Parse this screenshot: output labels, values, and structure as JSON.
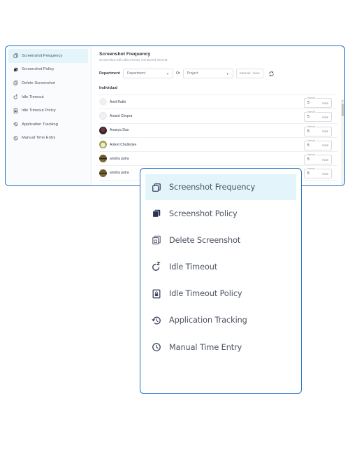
{
  "sidebar": {
    "items": [
      {
        "label": "Screenshot Frequency",
        "icon": "copy-icon",
        "active": true
      },
      {
        "label": "Screenshot Policy",
        "icon": "stacked-files-icon",
        "active": false
      },
      {
        "label": "Delete Screenshot",
        "icon": "delete-files-icon",
        "active": false
      },
      {
        "label": "Idle Timeout",
        "icon": "sleep-refresh-icon",
        "active": false
      },
      {
        "label": "Idle Timeout Policy",
        "icon": "locked-document-icon",
        "active": false
      },
      {
        "label": "Application Tracking",
        "icon": "history-icon",
        "active": false
      },
      {
        "label": "Manual Time Entry",
        "icon": "clock-icon",
        "active": false
      }
    ]
  },
  "main": {
    "title": "Screenshot Frequency",
    "subtitle": "Screenshot will collect below mentioned interval.",
    "filters": {
      "department_label": "Department",
      "department_value": "Department",
      "or_label": "Or",
      "project_value": "Project",
      "interval_placeholder": "Interval",
      "interval_unit": "mins"
    },
    "section_label": "Individual",
    "rows": [
      {
        "name": "Amit Rathi",
        "interval_label": "Interval",
        "interval": "5",
        "unit": "mins"
      },
      {
        "name": "Anand Chopra",
        "interval_label": "Interval",
        "interval": "5",
        "unit": "mins"
      },
      {
        "name": "Ananya Das",
        "interval_label": "Interval",
        "interval": "5",
        "unit": "mins"
      },
      {
        "name": "Aniket Chatterjee",
        "interval_label": "Interval",
        "interval": "5",
        "unit": "mins"
      },
      {
        "name": "anisha patra",
        "interval_label": "Interval",
        "interval": "5",
        "unit": "mins"
      },
      {
        "name": "anisha patra",
        "interval_label": "Interval",
        "interval": "5",
        "unit": "mins"
      }
    ]
  },
  "colors": {
    "accent_border": "#1f6fc4",
    "active_bg": "#e3f4fb",
    "icon_color": "#3d4560"
  }
}
